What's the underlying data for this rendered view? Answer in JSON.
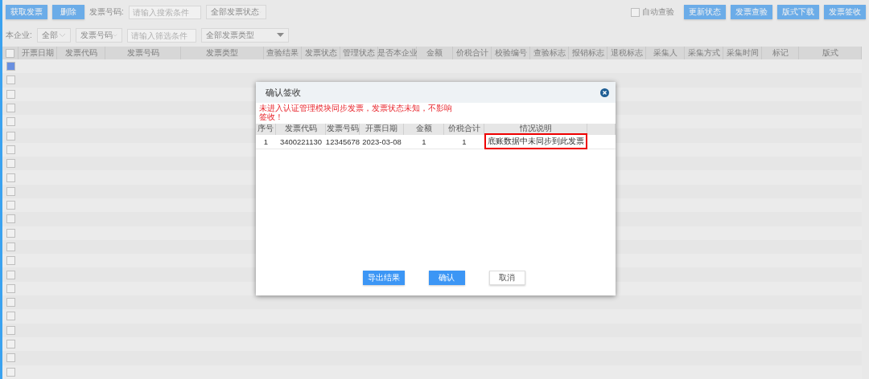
{
  "toolbar": {
    "buttons": [
      {
        "label": "获取发票"
      },
      {
        "label": "删除"
      }
    ],
    "search_label": "发票号码:",
    "search": {
      "placeholder": "请输入搜索条件"
    },
    "status_select": "全部发票状态",
    "auto_check": {
      "label": "自动查验",
      "checked": false
    },
    "actions": [
      {
        "label": "更新状态"
      },
      {
        "label": "发票查验"
      },
      {
        "label": "版式下载"
      },
      {
        "label": "发票签收"
      }
    ]
  },
  "filters": {
    "company_label": "本企业:",
    "company_select": "全部",
    "field_select": "发票号码",
    "filter": {
      "placeholder": "请输入筛选条件"
    },
    "type_select": "全部发票类型"
  },
  "table": {
    "columns": [
      "开票日期",
      "发票代码",
      "发票号码",
      "发票类型",
      "查验结果",
      "发票状态",
      "管理状态",
      "是否本企业",
      "金额",
      "价税合计",
      "校验编号",
      "查验标志",
      "报销标志",
      "退税标志",
      "采集人",
      "采集方式",
      "采集时间",
      "标记",
      "版式"
    ],
    "all_checked": false,
    "rows": [
      {
        "checked": true
      },
      {
        "checked": false
      },
      {
        "checked": false
      },
      {
        "checked": false
      },
      {
        "checked": false
      },
      {
        "checked": false
      },
      {
        "checked": false
      },
      {
        "checked": false
      },
      {
        "checked": false
      },
      {
        "checked": false
      },
      {
        "checked": false
      },
      {
        "checked": false
      },
      {
        "checked": false
      },
      {
        "checked": false
      },
      {
        "checked": false
      },
      {
        "checked": false
      },
      {
        "checked": false
      },
      {
        "checked": false
      },
      {
        "checked": false
      },
      {
        "checked": false
      },
      {
        "checked": false
      },
      {
        "checked": false
      },
      {
        "checked": false
      }
    ]
  },
  "dialog": {
    "title": "确认签收",
    "message": "未进入认证管理模块同步发票，发票状态未知，不影响签收！",
    "columns": [
      "序号",
      "发票代码",
      "发票号码",
      "开票日期",
      "金额",
      "价税合计",
      "情况说明"
    ],
    "rows": [
      {
        "cells": [
          "1",
          "3400221130",
          "12345678",
          "2023-03-08",
          "1",
          "1",
          "底账数据中未同步到此发票"
        ],
        "highlighted": true
      }
    ],
    "buttons": [
      {
        "label": "导出结果",
        "kind": "primary"
      },
      {
        "label": "确认",
        "kind": "primary"
      },
      {
        "label": "取消",
        "kind": "plain"
      }
    ]
  }
}
